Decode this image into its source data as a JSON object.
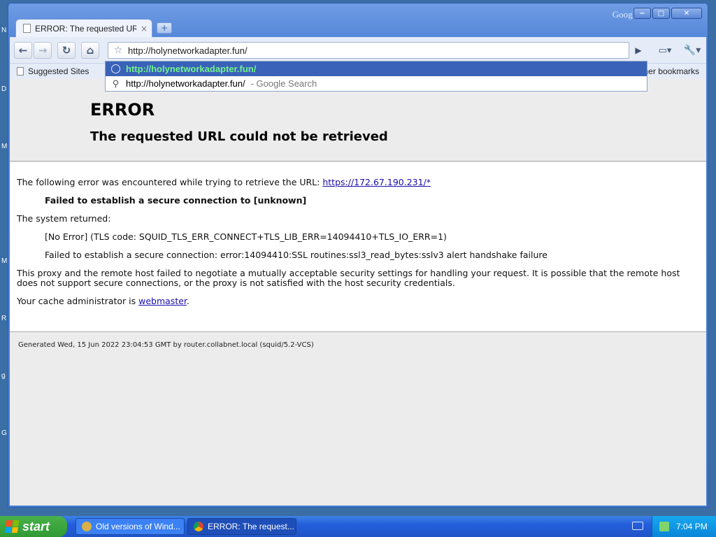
{
  "desktop": {
    "edge_letters": [
      "N",
      "D",
      "M",
      "M",
      "R",
      "g",
      "G"
    ]
  },
  "window": {
    "brand": "Google",
    "controls": {
      "minimize": "−",
      "maximize": "□",
      "close": "✕"
    }
  },
  "tab": {
    "title": "ERROR: The requested UR...",
    "close": "×",
    "new_tab": "+"
  },
  "toolbar": {
    "url": "http://holynetworkadapter.fun/",
    "back": "←",
    "forward": "→",
    "reload": "↻",
    "home": "⌂",
    "star": "☆",
    "go": "▶",
    "page_menu": "▭▾",
    "wrench": "🔧▾"
  },
  "bookmarks": {
    "suggested": "Suggested Sites",
    "other": "Other bookmarks"
  },
  "autocomplete": {
    "items": [
      {
        "text": "http://holynetworkadapter.fun/",
        "suffix": ""
      },
      {
        "text": "http://holynetworkadapter.fun/",
        "suffix": " - Google Search"
      }
    ]
  },
  "page": {
    "title": "ERROR",
    "subtitle": "The requested URL could not be retrieved",
    "encountered_prefix": "The following error was encountered while trying to retrieve the URL: ",
    "encountered_url": "https://172.67.190.231/*",
    "failed_label": "Failed to establish a secure connection to [unknown]",
    "system_returned": "The system returned:",
    "tls_code": "[No Error] (TLS code: SQUID_TLS_ERR_CONNECT+TLS_LIB_ERR=14094410+TLS_IO_ERR=1)",
    "ssl_error": "Failed to establish a secure connection: error:14094410:SSL routines:ssl3_read_bytes:sslv3 alert handshake failure",
    "explanation": "This proxy and the remote host failed to negotiate a mutually acceptable security settings for handling your request. It is possible that the remote host does not support secure connections, or the proxy is not satisfied with the host security credentials.",
    "admin_prefix": "Your cache administrator is ",
    "admin_link": "webmaster",
    "admin_suffix": ".",
    "generated": "Generated Wed, 15 Jun 2022 23:04:53 GMT by router.collabnet.local (squid/5.2-VCS)"
  },
  "taskbar": {
    "start": "start",
    "tasks": [
      {
        "label": "Old versions of Wind..."
      },
      {
        "label": "ERROR: The request..."
      }
    ],
    "clock": "7:04 PM"
  },
  "colors": {
    "link": "#1a0dab",
    "autocomplete_selected_bg": "#3a62b8",
    "autocomplete_selected_text": "#71f48c"
  }
}
